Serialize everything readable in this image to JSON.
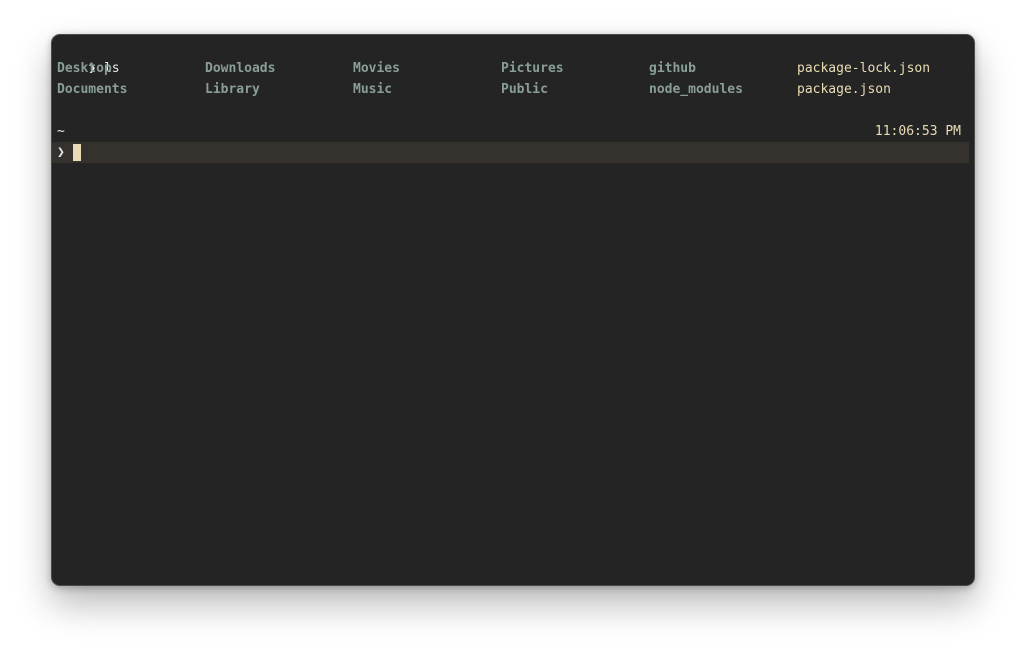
{
  "terminal": {
    "history": {
      "prompt_symbol": "❯",
      "command": "ls"
    },
    "listing": {
      "row1": [
        "Desktop",
        "Downloads",
        "Movies",
        "Pictures",
        "github",
        "package-lock.json"
      ],
      "row2": [
        "Documents",
        "Library",
        "Music",
        "Public",
        "node_modules",
        "package.json"
      ],
      "types_row1": [
        "dir",
        "dir",
        "dir",
        "dir",
        "dir",
        "file"
      ],
      "types_row2": [
        "dir",
        "dir",
        "dir",
        "dir",
        "dir",
        "file"
      ]
    },
    "status": {
      "cwd": "~",
      "time": "11:06:53 PM"
    },
    "input": {
      "prompt_symbol": "❯",
      "value": ""
    }
  },
  "colors": {
    "background": "#242424",
    "directory": "#8a9e98",
    "file": "#e9dcb5",
    "active_line": "#35312d",
    "cursor": "#e9dcb5"
  }
}
